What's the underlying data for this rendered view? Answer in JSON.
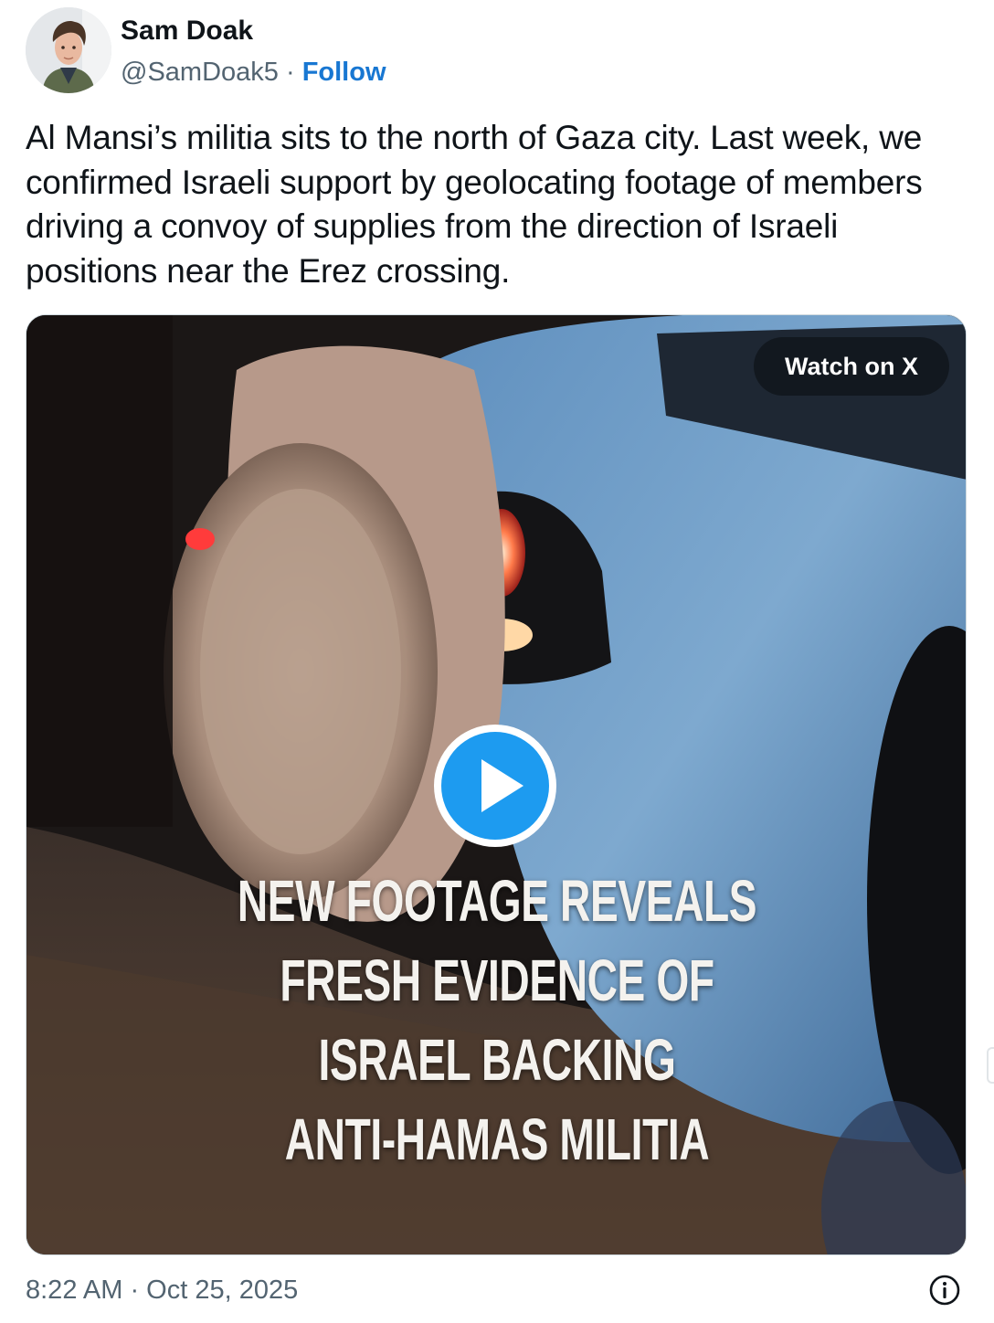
{
  "author": {
    "name": "Sam Doak",
    "handle": "@SamDoak5",
    "separator": " · ",
    "follow_label": "Follow"
  },
  "tweet": {
    "text": "Al Mansi’s militia sits to the north of Gaza city. Last week, we confirmed Israeli support by geolocating footage of members driving a convoy of supplies from the direction of Israeli positions near the Erez crossing."
  },
  "media": {
    "watch_label": "Watch on X",
    "headline_lines": [
      "NEW FOOTAGE REVEALS",
      "FRESH EVIDENCE OF",
      "ISRAEL BACKING",
      "ANTI-HAMAS MILITIA"
    ],
    "play_icon": "play-icon"
  },
  "footer": {
    "timestamp": "8:22 AM · Oct 25, 2025",
    "info_icon": "info-icon"
  },
  "colors": {
    "link": "#1877d2",
    "play": "#1d9bf0",
    "secondary_text": "#536471",
    "primary_text": "#0f1419"
  }
}
